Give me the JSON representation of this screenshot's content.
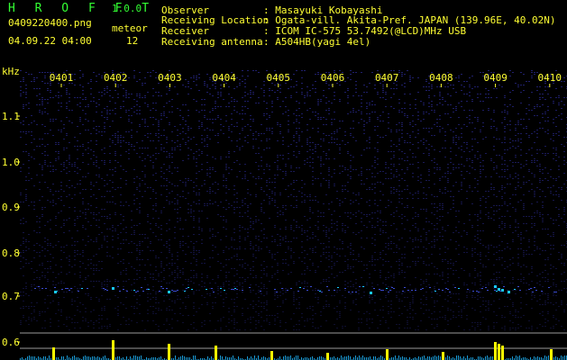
{
  "app": {
    "title": "H R O F F T",
    "version": "1.0.0"
  },
  "file": {
    "name": "0409220400.png",
    "datetime": "04.09.22 04:00",
    "count_label": "meteor",
    "count": "12"
  },
  "info": {
    "rows": [
      {
        "label": "Observer",
        "value": ": Masayuki Kobayashi"
      },
      {
        "label": "Receiving Location",
        "value": ": Ogata-vill. Akita-Pref. JAPAN (139.96E, 40.02N)"
      },
      {
        "label": "Receiver",
        "value": ": ICOM IC-575 53.7492(@LCD)MHz USB"
      },
      {
        "label": "Receiving antenna",
        "value": ": A504HB(yagi 4el)"
      }
    ]
  },
  "spectrogram": {
    "unit_label": "kHz",
    "time_labels": [
      "0401",
      "0402",
      "0403",
      "0404",
      "0405",
      "0406",
      "0407",
      "0408",
      "0409",
      "0410"
    ],
    "freq_labels": [
      "1.1",
      "1.0",
      "0.9",
      "0.8",
      "0.7",
      "0.6"
    ],
    "colors": {
      "background": "#000000",
      "noise": "#2a2a90",
      "label": "#ffff33",
      "title": "#33ff33",
      "trace": "#19c9ff",
      "peak": "#ffff00"
    }
  }
}
